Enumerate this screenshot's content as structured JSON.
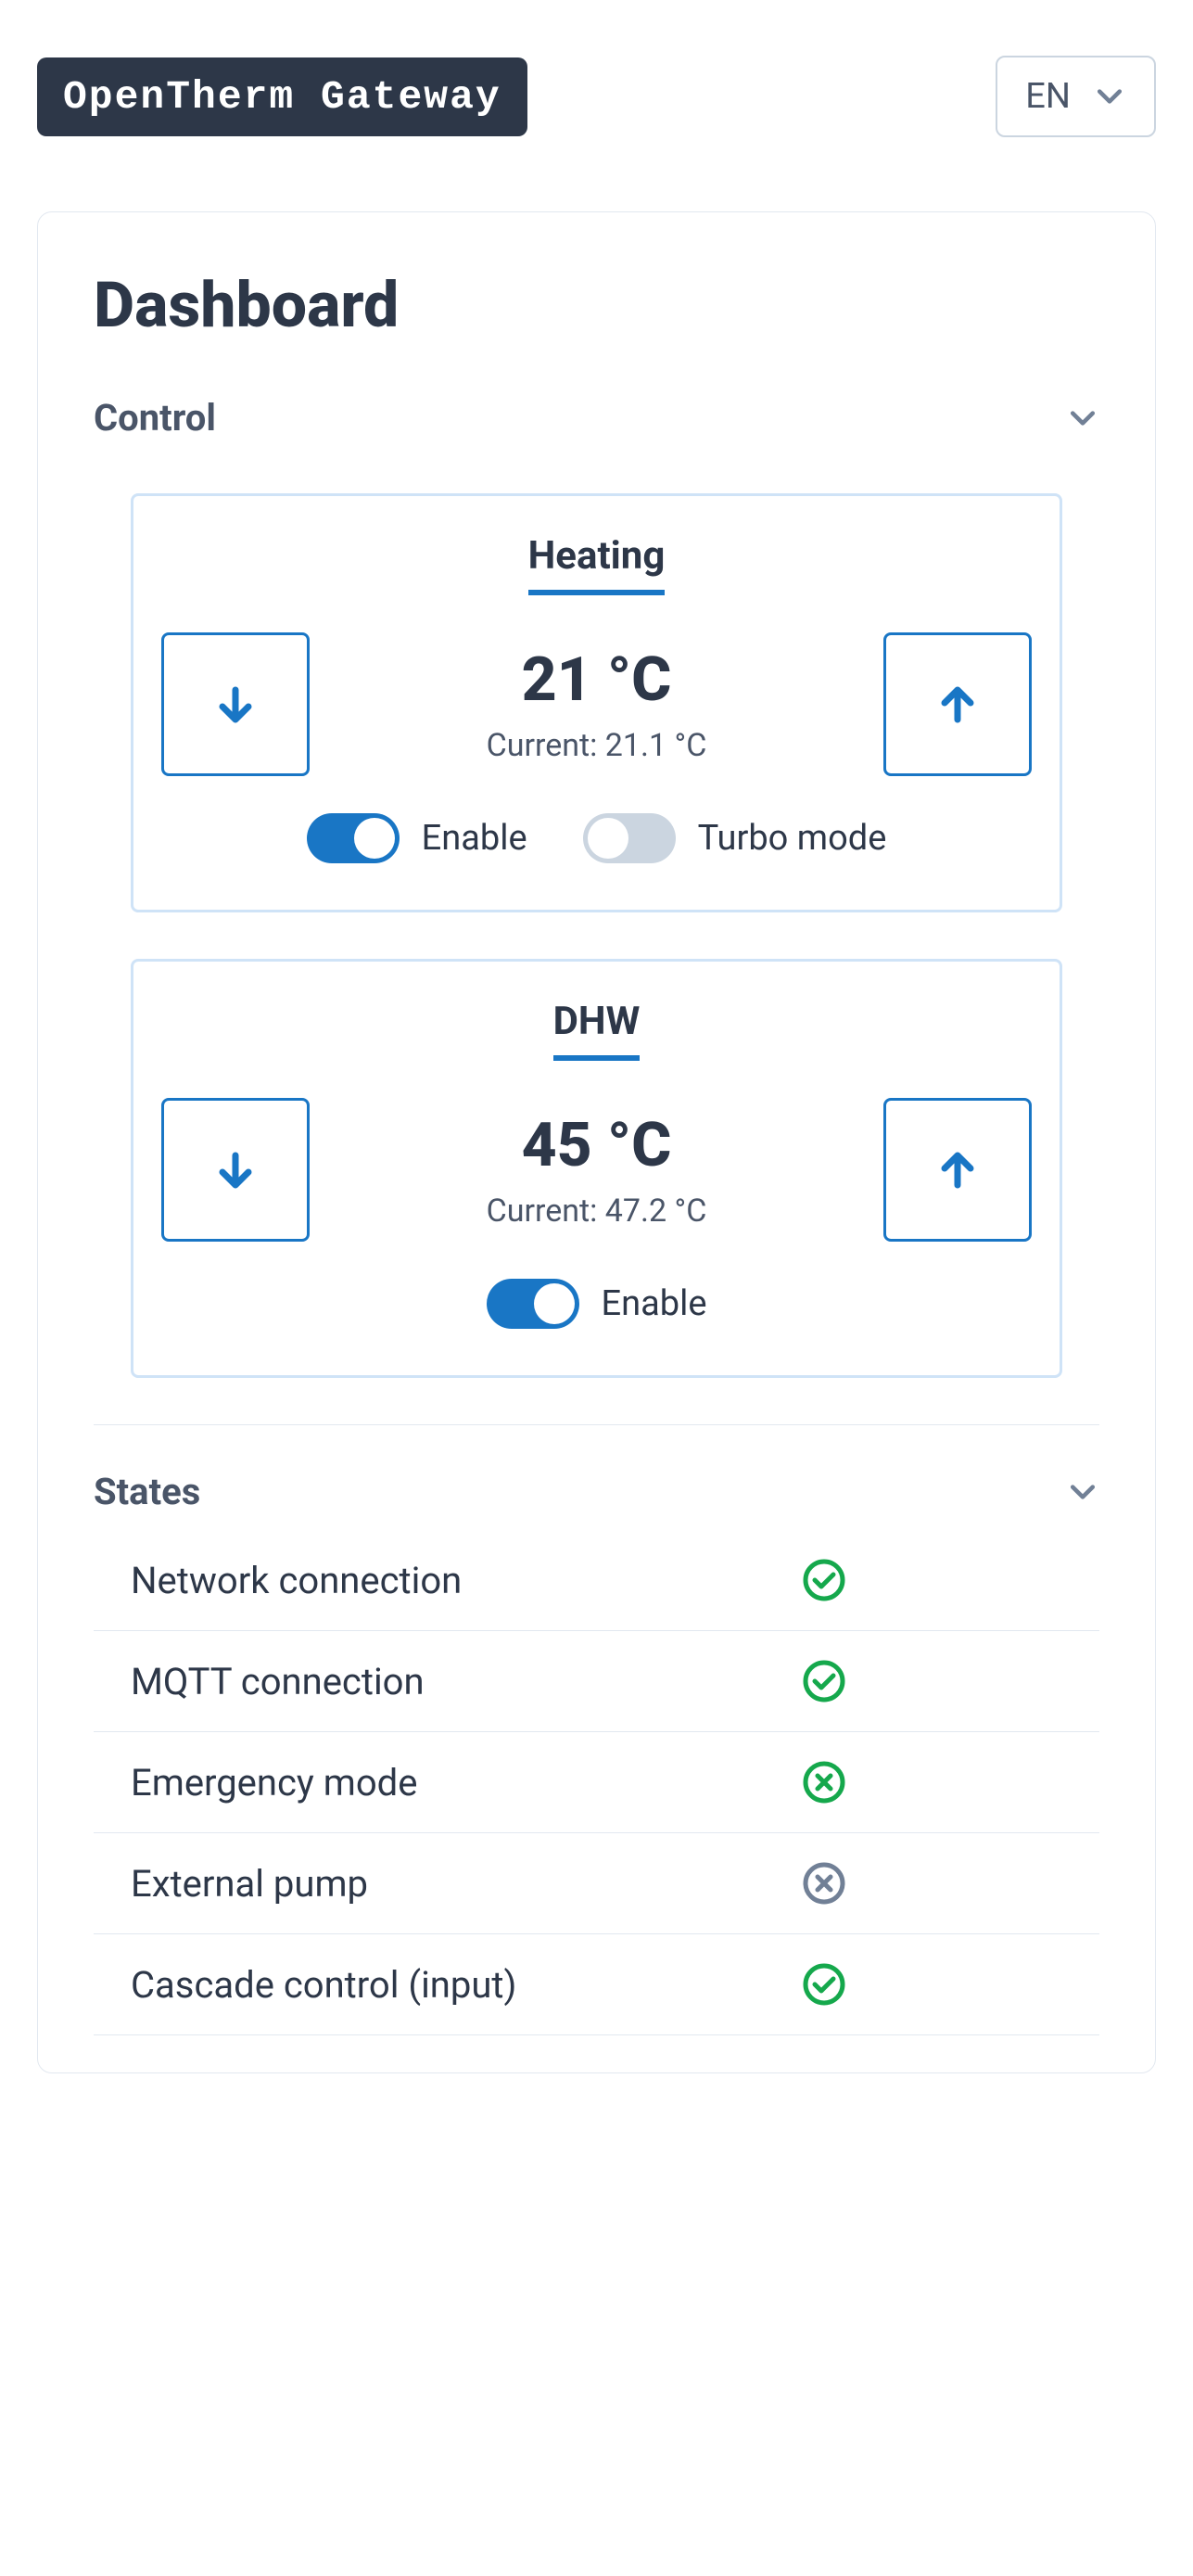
{
  "header": {
    "brand": "OpenTherm Gateway",
    "lang": "EN"
  },
  "dashboard": {
    "title": "Dashboard",
    "sections": {
      "control": {
        "title": "Control",
        "heating": {
          "title": "Heating",
          "setpoint": "21 °C",
          "current_label": "Current: 21.1 °C",
          "enable_label": "Enable",
          "turbo_label": "Turbo mode",
          "enable_on": true,
          "turbo_on": false
        },
        "dhw": {
          "title": "DHW",
          "setpoint": "45 °C",
          "current_label": "Current: 47.2 °C",
          "enable_label": "Enable",
          "enable_on": true
        }
      },
      "states": {
        "title": "States",
        "items": [
          {
            "label": "Network connection",
            "status": "ok"
          },
          {
            "label": "MQTT connection",
            "status": "ok"
          },
          {
            "label": "Emergency mode",
            "status": "off-green"
          },
          {
            "label": "External pump",
            "status": "off-gray"
          },
          {
            "label": "Cascade control (input)",
            "status": "ok"
          }
        ]
      }
    }
  },
  "colors": {
    "accent": "#1976c5",
    "dark": "#2d3748",
    "muted": "#4a5568",
    "green": "#15a84c",
    "gray": "#718096"
  }
}
